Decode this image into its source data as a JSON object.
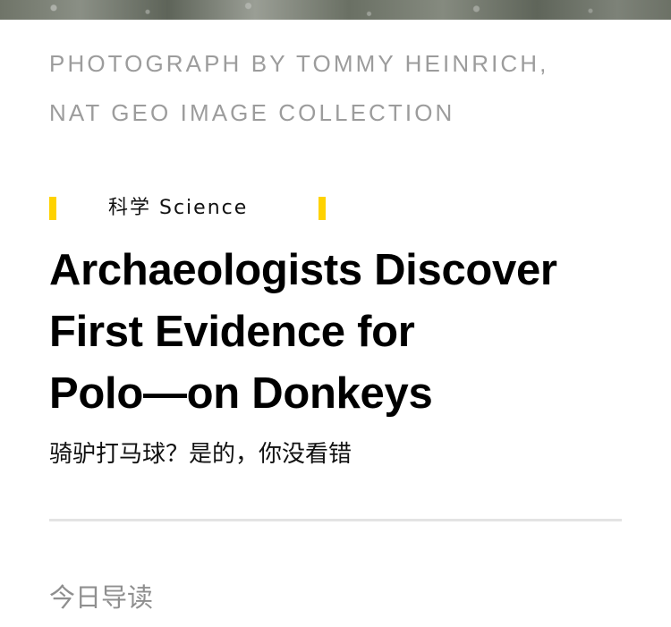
{
  "photo_credit": {
    "line1": "PHOTOGRAPH BY TOMMY HEINRICH,",
    "line2": "NAT GEO IMAGE COLLECTION"
  },
  "category_tag": {
    "label": "科学  Science",
    "accent_color": "#ffd200"
  },
  "article": {
    "headline_lines": [
      "Archaeologists Discover",
      "First Evidence for",
      "Polo—on Donkeys"
    ],
    "subtitle": "骑驴打马球？是的，你没看错"
  },
  "section": {
    "heading": "今日导读"
  }
}
